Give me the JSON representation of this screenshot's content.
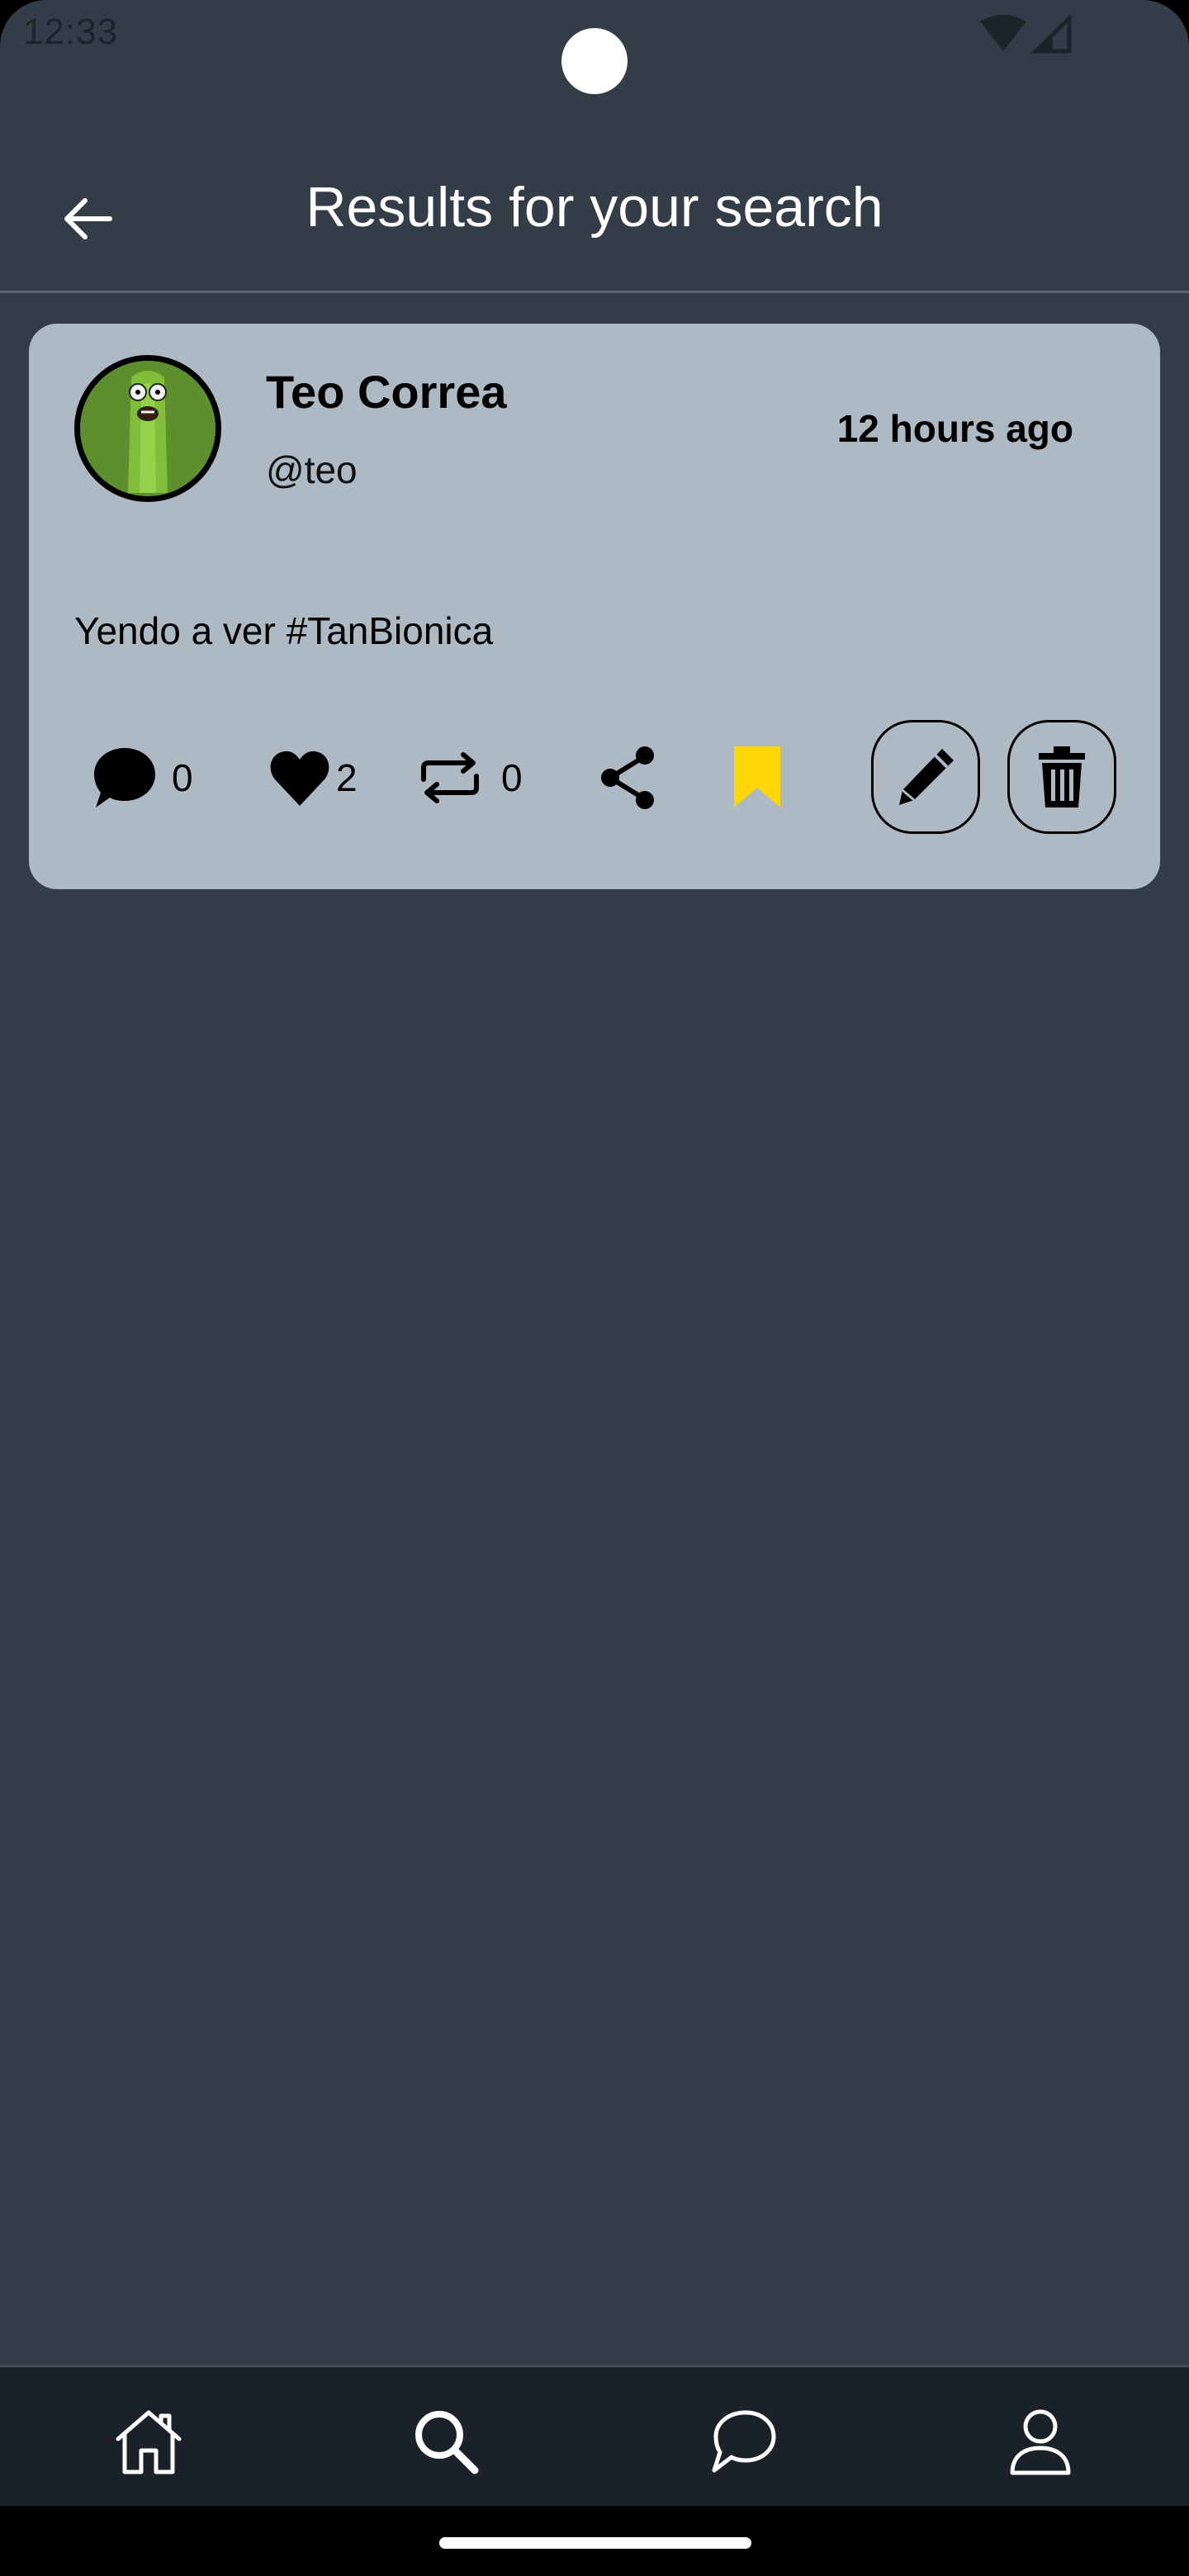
{
  "status_bar": {
    "time": "12:33",
    "icons": [
      "wifi-icon",
      "cell-signal-icon"
    ]
  },
  "header": {
    "title": "Results for your search",
    "back_icon": "arrow-left-icon"
  },
  "post": {
    "author_name": "Teo Correa",
    "author_handle": "@teo",
    "time_ago": "12 hours ago",
    "text": "Yendo a ver #TanBionica",
    "comments_count": "0",
    "likes_count": "2",
    "reposts_count": "0",
    "bookmarked": true,
    "bookmark_color": "#ffd60a",
    "card_color": "#adb9c3"
  },
  "bottom_nav": {
    "items": [
      {
        "icon": "home-icon"
      },
      {
        "icon": "search-icon"
      },
      {
        "icon": "chat-icon"
      },
      {
        "icon": "profile-icon"
      }
    ]
  },
  "colors": {
    "background": "#333d47",
    "nav_background": "#1a2129",
    "accent_bookmark": "#ffd60a"
  }
}
